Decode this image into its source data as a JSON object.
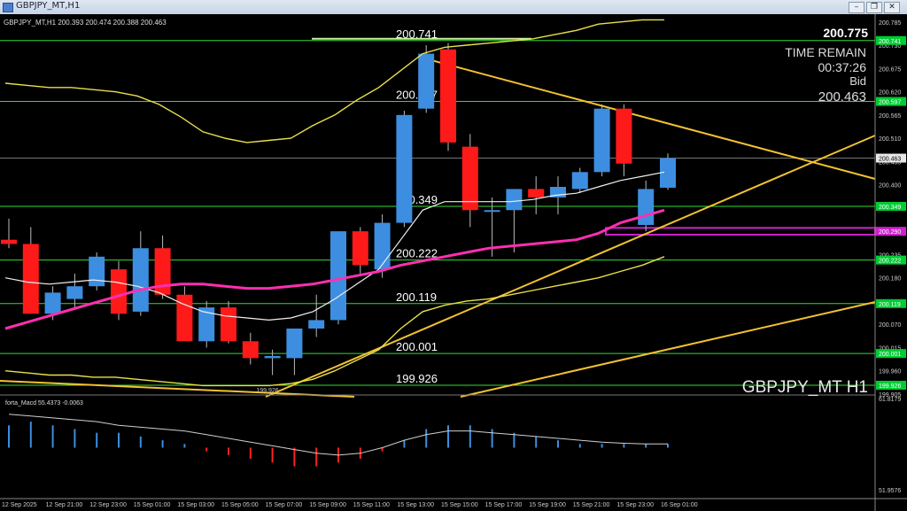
{
  "window": {
    "title": "GBPJPY_MT,H1",
    "minimize": "–",
    "maximize": "❐",
    "close": "✕"
  },
  "chart_info": {
    "header": "GBPJPY_MT,H1  200.393 200.474 200.388 200.463",
    "symbol_watermark": "GBPJPY_MT H1",
    "top_price": "200.775",
    "time_remain_label": "TIME REMAIN",
    "time_remain": "00:37:26",
    "bid_label": "Bid",
    "bid": "200.463",
    "level_labels": [
      "200.741",
      "200.597",
      "200.349",
      "200.222",
      "200.119",
      "200.001",
      "199.926"
    ],
    "low_marker": "199.926",
    "macd_header": "forta_Macd 55.4373  -0.0063",
    "macd_top": "61.8179",
    "macd_bottom": "51.9576"
  },
  "colors": {
    "bull": "#3d8ee0",
    "bear": "#ff1a1a",
    "level": "#33dd33",
    "trend": "#f2c230",
    "ma_pink": "#ff2fb0",
    "ma_white": "#f0f0f0",
    "band": "#e8e04a",
    "support_box": "#cc22cc",
    "label_green_bg": "#00cc33"
  },
  "chart_data": {
    "type": "candlestick",
    "ylim": [
      199.905,
      200.795
    ],
    "price_ticks": [
      "200.785",
      "200.730",
      "200.675",
      "200.620",
      "200.565",
      "200.510",
      "200.455",
      "200.400",
      "200.345",
      "200.290",
      "200.235",
      "200.180",
      "200.125",
      "200.070",
      "200.015",
      "199.960",
      "199.905"
    ],
    "price_tick_values": [
      200.785,
      200.73,
      200.675,
      200.62,
      200.565,
      200.51,
      200.455,
      200.4,
      200.345,
      200.29,
      200.235,
      200.18,
      200.125,
      200.07,
      200.015,
      199.96,
      199.905
    ],
    "highlighted_price_labels": [
      "200.741",
      "200.597",
      "200.463",
      "200.349",
      "200.290",
      "200.222",
      "200.119",
      "200.001",
      "199.926"
    ],
    "highlighted_price_values": [
      200.741,
      200.597,
      200.463,
      200.349,
      200.29,
      200.222,
      200.119,
      200.001,
      199.926
    ],
    "level_values": [
      200.741,
      200.597,
      200.349,
      200.222,
      200.119,
      200.001,
      199.926
    ],
    "time_labels": [
      "12 Sep 2025",
      "12 Sep 21:00",
      "12 Sep 23:00",
      "15 Sep 01:00",
      "15 Sep 03:00",
      "15 Sep 05:00",
      "15 Sep 07:00",
      "15 Sep 09:00",
      "15 Sep 11:00",
      "15 Sep 13:00",
      "15 Sep 15:00",
      "15 Sep 17:00",
      "15 Sep 19:00",
      "15 Sep 21:00",
      "15 Sep 23:00",
      "16 Sep 01:00"
    ],
    "candles": [
      {
        "o": 200.27,
        "h": 200.32,
        "l": 200.25,
        "c": 200.26
      },
      {
        "o": 200.26,
        "h": 200.3,
        "l": 200.13,
        "c": 200.095
      },
      {
        "o": 200.095,
        "h": 200.16,
        "l": 200.08,
        "c": 200.145
      },
      {
        "o": 200.13,
        "h": 200.19,
        "l": 200.11,
        "c": 200.16
      },
      {
        "o": 200.16,
        "h": 200.24,
        "l": 200.15,
        "c": 200.23
      },
      {
        "o": 200.2,
        "h": 200.22,
        "l": 200.08,
        "c": 200.095
      },
      {
        "o": 200.1,
        "h": 200.29,
        "l": 200.09,
        "c": 200.25
      },
      {
        "o": 200.25,
        "h": 200.28,
        "l": 200.13,
        "c": 200.14
      },
      {
        "o": 200.14,
        "h": 200.16,
        "l": 200.03,
        "c": 200.03
      },
      {
        "o": 200.03,
        "h": 200.125,
        "l": 200.015,
        "c": 200.11
      },
      {
        "o": 200.11,
        "h": 200.125,
        "l": 200.025,
        "c": 200.03
      },
      {
        "o": 200.03,
        "h": 200.05,
        "l": 199.975,
        "c": 199.99
      },
      {
        "o": 199.99,
        "h": 200.01,
        "l": 199.95,
        "c": 199.995
      },
      {
        "o": 199.99,
        "h": 200.06,
        "l": 199.95,
        "c": 200.06
      },
      {
        "o": 200.06,
        "h": 200.14,
        "l": 200.04,
        "c": 200.08
      },
      {
        "o": 200.08,
        "h": 200.29,
        "l": 200.07,
        "c": 200.29
      },
      {
        "o": 200.29,
        "h": 200.3,
        "l": 200.19,
        "c": 200.21
      },
      {
        "o": 200.2,
        "h": 200.33,
        "l": 200.18,
        "c": 200.31
      },
      {
        "o": 200.31,
        "h": 200.575,
        "l": 200.3,
        "c": 200.565
      },
      {
        "o": 200.58,
        "h": 200.73,
        "l": 200.57,
        "c": 200.71
      },
      {
        "o": 200.72,
        "h": 200.735,
        "l": 200.48,
        "c": 200.5
      },
      {
        "o": 200.49,
        "h": 200.52,
        "l": 200.3,
        "c": 200.34
      },
      {
        "o": 200.34,
        "h": 200.37,
        "l": 200.23,
        "c": 200.34
      },
      {
        "o": 200.34,
        "h": 200.38,
        "l": 200.24,
        "c": 200.39
      },
      {
        "o": 200.39,
        "h": 200.42,
        "l": 200.33,
        "c": 200.37
      },
      {
        "o": 200.37,
        "h": 200.42,
        "l": 200.33,
        "c": 200.395
      },
      {
        "o": 200.39,
        "h": 200.44,
        "l": 200.38,
        "c": 200.43
      },
      {
        "o": 200.43,
        "h": 200.59,
        "l": 200.42,
        "c": 200.58
      },
      {
        "o": 200.58,
        "h": 200.59,
        "l": 200.42,
        "c": 200.45
      },
      {
        "o": 200.305,
        "h": 200.41,
        "l": 200.29,
        "c": 200.39
      },
      {
        "o": 200.393,
        "h": 200.474,
        "l": 200.388,
        "c": 200.463
      }
    ],
    "ma_pink": [
      200.06,
      200.075,
      200.09,
      200.105,
      200.12,
      200.135,
      200.15,
      200.16,
      200.165,
      200.165,
      200.16,
      200.155,
      200.155,
      200.16,
      200.165,
      200.175,
      200.185,
      200.195,
      200.21,
      200.22,
      200.23,
      200.24,
      200.25,
      200.255,
      200.26,
      200.265,
      200.27,
      200.285,
      200.31,
      200.325,
      200.34
    ],
    "ma_white": [
      200.18,
      200.17,
      200.165,
      200.17,
      200.175,
      200.17,
      200.16,
      200.145,
      200.12,
      200.1,
      200.09,
      200.085,
      200.08,
      200.085,
      200.1,
      200.13,
      200.165,
      200.2,
      200.27,
      200.34,
      200.36,
      200.36,
      200.36,
      200.36,
      200.365,
      200.375,
      200.38,
      200.395,
      200.41,
      200.42,
      200.43
    ],
    "band_upper": [
      200.64,
      200.635,
      200.63,
      200.63,
      200.625,
      200.62,
      200.61,
      200.59,
      200.56,
      200.525,
      200.51,
      200.5,
      200.505,
      200.51,
      200.54,
      200.565,
      200.6,
      200.63,
      200.67,
      200.71,
      200.725,
      200.73,
      200.735,
      200.74,
      200.745,
      200.755,
      200.765,
      200.78,
      200.785,
      200.79,
      200.79
    ],
    "band_lower": [
      199.96,
      199.955,
      199.95,
      199.95,
      199.945,
      199.945,
      199.94,
      199.935,
      199.93,
      199.925,
      199.925,
      199.925,
      199.925,
      199.93,
      199.94,
      199.96,
      199.985,
      200.01,
      200.06,
      200.1,
      200.115,
      200.125,
      200.13,
      200.14,
      200.15,
      200.16,
      200.17,
      200.18,
      200.195,
      200.21,
      200.23
    ],
    "macd_hist": [
      0.6,
      0.7,
      0.6,
      0.5,
      0.4,
      0.4,
      0.3,
      0.2,
      0.1,
      -0.1,
      -0.2,
      -0.3,
      -0.4,
      -0.5,
      -0.5,
      -0.4,
      -0.3,
      -0.1,
      0.2,
      0.5,
      0.6,
      0.6,
      0.5,
      0.4,
      0.3,
      0.2,
      0.1,
      0.1,
      0.1,
      0.1,
      0.1
    ],
    "macd_signal": [
      0.9,
      0.85,
      0.8,
      0.75,
      0.7,
      0.6,
      0.55,
      0.5,
      0.45,
      0.35,
      0.25,
      0.15,
      0.05,
      -0.05,
      -0.15,
      -0.2,
      -0.15,
      0.0,
      0.2,
      0.35,
      0.45,
      0.45,
      0.4,
      0.35,
      0.3,
      0.25,
      0.2,
      0.15,
      0.12,
      0.1,
      0.1
    ]
  }
}
